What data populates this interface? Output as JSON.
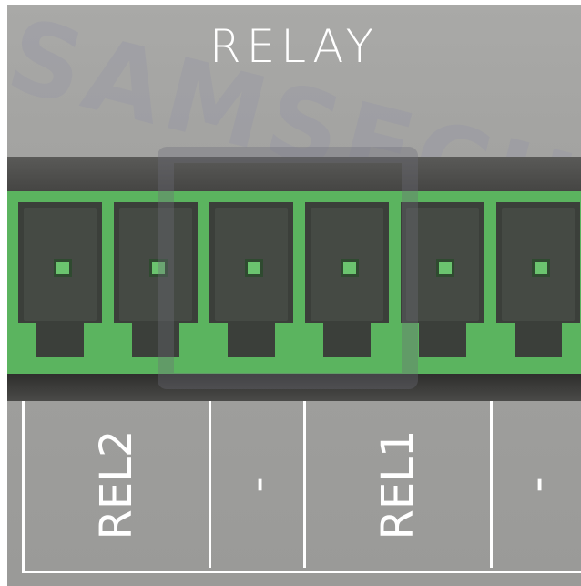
{
  "watermark_text": "SAMSECUR",
  "header": {
    "title": "RELAY"
  },
  "terminals": {
    "count": 6
  },
  "labels": {
    "cells": [
      {
        "text": "REL2"
      },
      {
        "text": "-"
      },
      {
        "text": "REL1"
      },
      {
        "text": "-"
      }
    ]
  },
  "colors": {
    "background": "#a2a2a0",
    "terminal_green": "#5bb45f",
    "terminal_dark": "#3e3e3c",
    "label_white": "#ffffff"
  }
}
